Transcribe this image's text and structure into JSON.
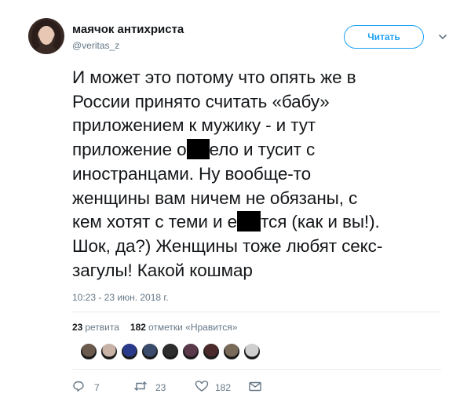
{
  "tweet": {
    "author": {
      "name": "маячок антихриста",
      "handle": "@veritas_z"
    },
    "follow_label": "Читать",
    "text_lines": [
      [
        "И может это потому что опять же в"
      ],
      [
        "России принято считать «бабу»"
      ],
      [
        "приложением к мужику - и тут"
      ],
      [
        "приложение о",
        "[redacted]",
        "ело и тусит с"
      ],
      [
        "иностранцами. Ну вообще-то"
      ],
      [
        "женщины вам ничем не обязаны, с"
      ],
      [
        "кем хотят с теми и е",
        "[redacted]",
        "тся (как и вы!)."
      ],
      [
        "Шок, да?) Женщины тоже любят секс-"
      ],
      [
        "загулы! Какой кошмар"
      ]
    ],
    "line_1": "И может это потому что опять же в",
    "line_2": "России принято считать «бабу»",
    "line_3": "приложением к мужику - и тут",
    "line_4a": "приложение о",
    "line_4b": "ело и тусит с",
    "line_5": "иностранцами. Ну вообще-то",
    "line_6": "женщины вам ничем не обязаны, с",
    "line_7a": "кем хотят с теми и е",
    "line_7b": "тся (как и вы!).",
    "line_8": "Шок, да?) Женщины тоже любят секс-",
    "line_9": "загулы! Какой кошмар",
    "timestamp": "10:23 - 23 июн. 2018 г.",
    "stats": {
      "retweets_count": "23",
      "retweets_label": "ретвита",
      "likes_count": "182",
      "likes_label": "отметки «Нравится»"
    },
    "liker_colors": [
      "#6b5a4e",
      "#c9b2a6",
      "#2a3a8a",
      "#3b4b6b",
      "#2d2d2d",
      "#5a3a4a",
      "#4a2a2a",
      "#7a6a5a",
      "#cfcfcf"
    ],
    "actions": {
      "reply_count": "7",
      "retweet_count": "23",
      "like_count": "182"
    }
  }
}
